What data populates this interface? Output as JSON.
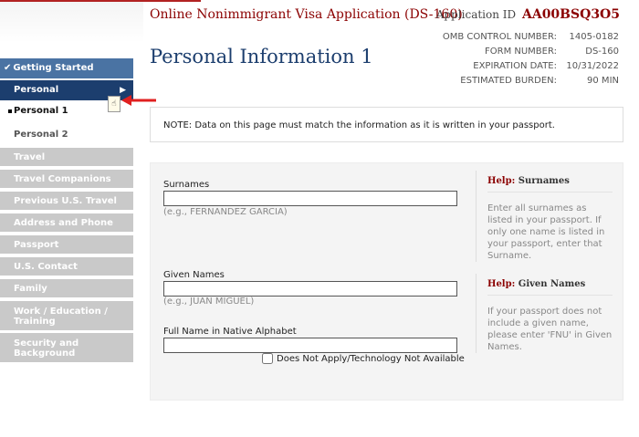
{
  "header": {
    "app_title": "Online Nonimmigrant Visa Application (DS-160)",
    "app_id_label": "Application ID",
    "app_id_value": "AA00BSQ3O5"
  },
  "page_title": "Personal Information 1",
  "omb": {
    "rows": [
      {
        "key": "OMB CONTROL NUMBER:",
        "value": "1405-0182"
      },
      {
        "key": "FORM NUMBER:",
        "value": "DS-160"
      },
      {
        "key": "EXPIRATION DATE:",
        "value": "10/31/2022"
      },
      {
        "key": "ESTIMATED BURDEN:",
        "value": "90 MIN"
      }
    ]
  },
  "sidebar": {
    "getting_started": "Getting Started",
    "getting_started_check": "✔",
    "personal": "Personal",
    "personal_arrow": "▶",
    "personal_1": "Personal 1",
    "personal_2": "Personal 2",
    "items": [
      "Travel",
      "Travel Companions",
      "Previous U.S. Travel",
      "Address and Phone",
      "Passport",
      "U.S. Contact",
      "Family",
      "Work / Education / Training",
      "Security and Background"
    ]
  },
  "notice": "NOTE: Data on this page must match the information as it is written in your passport.",
  "form": {
    "surnames_label": "Surnames",
    "surnames_value": "",
    "surnames_example": "(e.g., FERNANDEZ GARCIA)",
    "given_label": "Given Names",
    "given_value": "",
    "given_example": "(e.g., JUAN MIGUEL)",
    "native_label": "Full Name in Native Alphabet",
    "native_value": "",
    "na_checkbox_label": "Does Not Apply/Technology Not Available",
    "na_checked": false
  },
  "help": {
    "prefix": "Help:",
    "surnames_topic": "Surnames",
    "surnames_body": "Enter all surnames as listed in your passport. If only one name is listed in your passport, enter that Surname.",
    "given_topic": "Given Names",
    "given_body": "If your passport does not include a given name, please enter 'FNU' in Given Names."
  },
  "colors": {
    "accent_red": "#8b0000",
    "nav_dark": "#1c3e6e",
    "nav_light": "#4a73a3",
    "nav_disabled": "#c9c9c9",
    "arrow_red": "#e02020"
  }
}
